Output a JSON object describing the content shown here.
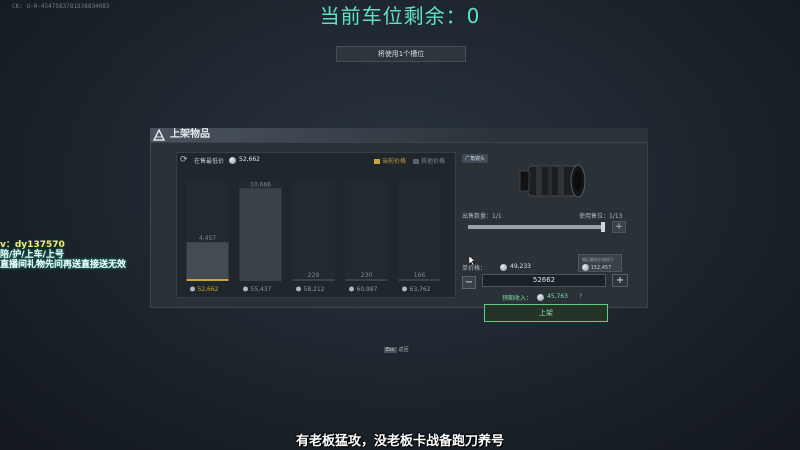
{
  "header": {
    "session_id": "CK: U-0-4547583781838834083",
    "slots_title": "当前车位剩余：0",
    "slot_button": "将使用1个槽位"
  },
  "stream_overlay": {
    "line1": "v：dy137570",
    "line2": "陪/护/上车/上号",
    "line3": "直播间礼物先问再送直接送无效"
  },
  "panel": {
    "title": "上架物品",
    "lowest_price_label": "在售最低价",
    "lowest_price_value": "52,662",
    "legend_selected": "当前价格",
    "legend_other": "其他价格"
  },
  "chart_data": {
    "type": "bar",
    "categories": [
      "52,662",
      "55,437",
      "58,212",
      "60,987",
      "63,762"
    ],
    "values": [
      4457,
      10666,
      229,
      230,
      166
    ],
    "value_labels": [
      "4,457",
      "10,666",
      "229",
      "230",
      "166"
    ],
    "selected_index": 0,
    "ylim": [
      0,
      11500
    ]
  },
  "item": {
    "tag": "广角镜头",
    "quantity_label": "出售数量：1/1",
    "slots_label": "使用售位：1/13",
    "quantity_fraction": 1.0,
    "tooltip_line1": "税后最低价格低于",
    "tooltip_line2": "152,457",
    "unit_price_label": "单价格：",
    "unit_price_value": "49,233",
    "price_input": "52662",
    "income_label": "预期收入：",
    "income_value": "45,763",
    "income_help": "?",
    "list_button": "上架",
    "minus": "−",
    "plus": "+"
  },
  "footer": {
    "esc_key": "Esc",
    "esc_label": "返回",
    "subtitle": "有老板猛攻，没老板卡战备跑刀养号"
  },
  "colors": {
    "accent_gold": "#c9a43c",
    "accent_green": "#5fcf86",
    "title_teal": "#5fe0c8"
  }
}
